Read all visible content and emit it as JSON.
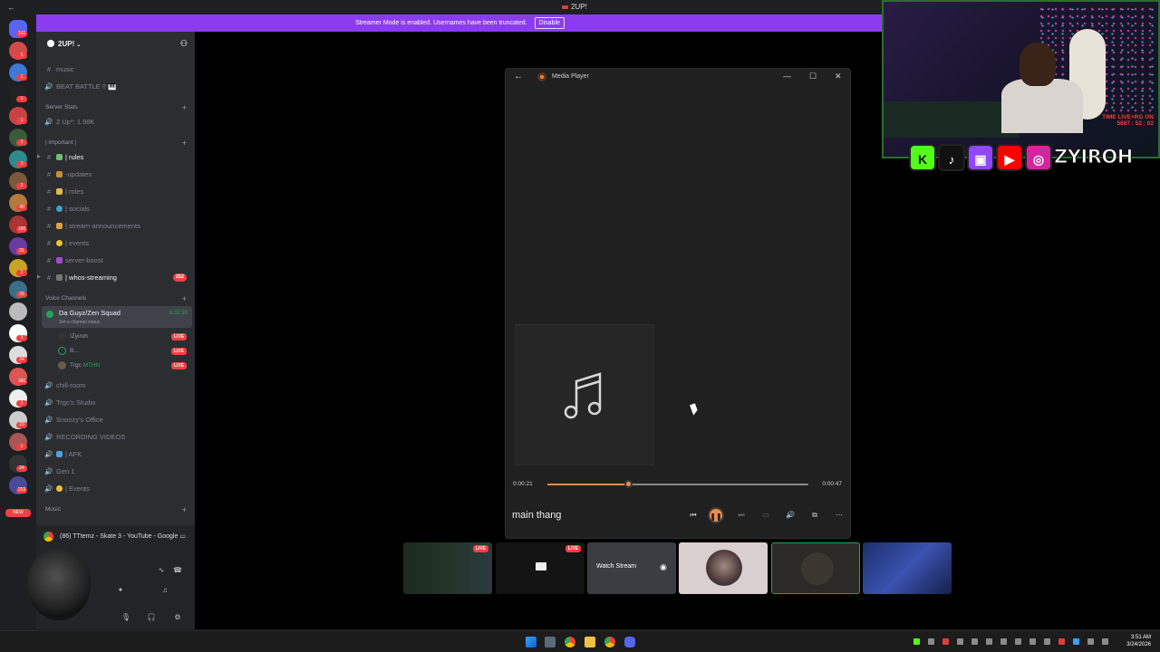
{
  "window": {
    "title": "2UP!",
    "back_icon": "arrow-left-icon"
  },
  "banner": {
    "text": "Streamer Mode is enabled. Usernames have been truncated.",
    "button": "Disable"
  },
  "rail": {
    "badges": [
      "161",
      "1",
      "1",
      "1",
      "1",
      "2",
      "3",
      "2",
      "40",
      "180",
      "31",
      "2",
      "25",
      "",
      "3",
      "24",
      "380",
      "1",
      "23",
      "1",
      "24",
      "253"
    ],
    "new_label": "NEW"
  },
  "guild": {
    "name": "2UP!"
  },
  "channels": {
    "top": [
      {
        "name": "music"
      },
      {
        "name": "BEAT BATTLE !! 🎹"
      }
    ],
    "server_stats": {
      "label": "Server Stats",
      "item": "2 Up*: 1.98K"
    },
    "important": {
      "label": "| important |",
      "items": [
        {
          "name": "| rules",
          "bright": true
        },
        {
          "name": "-updates"
        },
        {
          "name": "| roles"
        },
        {
          "name": "| socials"
        },
        {
          "name": "| stream-announcements"
        },
        {
          "name": "| events"
        },
        {
          "name": "server-boost"
        },
        {
          "name": "| whos-streaming",
          "bright": true,
          "count": "252"
        }
      ]
    },
    "voice": {
      "label": "Voice Channels",
      "active": {
        "name": "Da Guyz/Zen Squad",
        "status": "Set a channel status",
        "time": "5:32:30"
      },
      "users": [
        {
          "name": "!Zyiroh",
          "live": "LIVE"
        },
        {
          "name": "B...",
          "live": "LIVE"
        },
        {
          "name": "Trgc",
          "tag": "MTHN",
          "live": "LIVE"
        }
      ],
      "others": [
        "chill-room",
        "Trgc's Studio",
        "Snoozy's Office",
        "RECORDING VIDEOS",
        "| AFK",
        "Gen 1",
        "| Events"
      ]
    },
    "music_category": "Music"
  },
  "activity": {
    "text": "(86) TTtemz - Skate 3 - YouTube - Google ..."
  },
  "player": {
    "app_title": "Media Player",
    "elapsed": "0:00:21",
    "total": "0:00:47",
    "progress": 0.31,
    "song": "main thang"
  },
  "overlay": {
    "timer_line1": "TIME LIVE+RG ON",
    "timer_line2": "5867 : 52 : 02",
    "handle": "ZYIROH",
    "socials": [
      "K",
      "tiktok-icon",
      "twitch-icon",
      "youtube-icon",
      "instagram-icon"
    ]
  },
  "tiles": {
    "live": "LIVE",
    "watch": "Watch Stream"
  },
  "taskbar": {
    "time": "3:51 AM",
    "date": "3/24/2026"
  },
  "colors": {
    "accent": "#8c3cf0",
    "player_accent": "#f08a4b",
    "live_red": "#f23f43",
    "online": "#23a55a"
  }
}
